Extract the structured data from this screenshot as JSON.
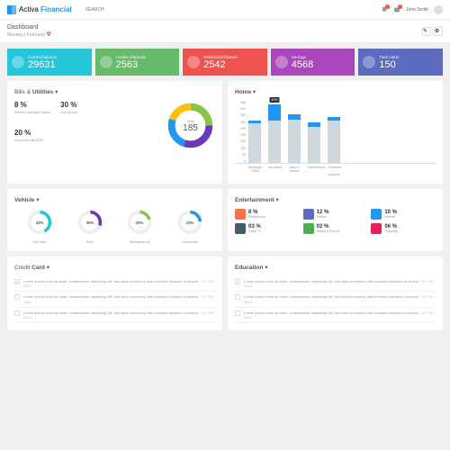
{
  "header": {
    "logo_a": "Activa",
    "logo_b": "Financial",
    "search_placeholder": "SEARCH",
    "notif1": "2",
    "notif2": "3",
    "username": "John Smith"
  },
  "subheader": {
    "title": "Dashboard",
    "date": "Monday | February"
  },
  "tiles": [
    {
      "label": "Current balance",
      "value": "29631"
    },
    {
      "label": "Credits /deposits",
      "value": "2563"
    },
    {
      "label": "Debits/withdrawals",
      "value": "2542"
    },
    {
      "label": "Savings",
      "value": "4568"
    },
    {
      "label": "Total Alerts",
      "value": "150"
    }
  ],
  "bills": {
    "title_a": "Bills &",
    "title_b": "Utilities",
    "stats": [
      {
        "val": "8 %",
        "lbl": "Electric and gas,Water"
      },
      {
        "val": "30 %",
        "lbl": "Cell phone"
      },
      {
        "val": "20 %",
        "lbl": "Land line bill AT&T"
      }
    ],
    "total_label": "Total",
    "total_value": "185"
  },
  "home": {
    "title": "Home",
    "tooltip": "40%"
  },
  "vehicle": {
    "title": "Vehicle",
    "items": [
      {
        "val": "42%",
        "lbl": "Car loan",
        "color": "#26c6da",
        "pct": 42
      },
      {
        "val": "30%",
        "lbl": "Fuel",
        "color": "#673ab7",
        "pct": 30
      },
      {
        "val": "20%",
        "lbl": "Maintenance",
        "color": "#8bc34a",
        "pct": 20
      },
      {
        "val": "23%",
        "lbl": "Insurance",
        "color": "#2196f3",
        "pct": 23
      }
    ]
  },
  "entertainment": {
    "title": "Entertainment",
    "items": [
      {
        "val": "8 %",
        "lbl": "Restaurants",
        "color": "#ff7043"
      },
      {
        "val": "12 %",
        "lbl": "Movies",
        "color": "#5c6bc0"
      },
      {
        "val": "10 %",
        "lbl": "Internet",
        "color": "#2196f3"
      },
      {
        "val": "03 %",
        "lbl": "Cable TV",
        "color": "#455a64"
      },
      {
        "val": "02 %",
        "lbl": "Health & Fitness",
        "color": "#4caf50"
      },
      {
        "val": "06 %",
        "lbl": "Shopping",
        "color": "#e91e63"
      }
    ]
  },
  "credit": {
    "title_a": "Credit",
    "title_b": "Card",
    "items": [
      {
        "checked": true,
        "text": "Lorem ipsum dolor sit amet, consectetuer adipiscing elit, sed diam nonummy nibh euismod tincidunt ut laoreet .",
        "date": "12 / 05 / 2014"
      },
      {
        "checked": false,
        "text": "Lorem ipsum dolor sit amet, consectetuer adipiscing elit, sed diam nonummy nibh euismod tincidunt ut laoreet .",
        "date": "12 / 05 / 2014"
      },
      {
        "checked": false,
        "text": "Lorem ipsum dolor sit amet, consectetuer adipiscing elit, sed diam nonummy nibh euismod tincidunt ut laoreet .",
        "date": "12 / 05 / 2014"
      }
    ]
  },
  "education": {
    "title": "Education",
    "items": [
      {
        "checked": true,
        "text": "Lorem ipsum dolor sit amet, consectetuer adipiscing elit, sed diam nonummy nibh euismod tincidunt ut laoreet .",
        "date": "12 / 05 / 2014"
      },
      {
        "checked": false,
        "text": "Lorem ipsum dolor sit amet, consectetuer adipiscing elit, sed diam nonummy nibh euismod tincidunt ut laoreet .",
        "date": "12 / 05 / 2014"
      },
      {
        "checked": false,
        "text": "Lorem ipsum dolor sit amet, consectetuer adipiscing elit, sed diam nonummy nibh euismod tincidunt ut laoreet .",
        "date": "12 / 05 / 2014"
      }
    ]
  },
  "chart_data": {
    "bills_donut": {
      "type": "pie",
      "title": "Bills & Utilities",
      "total": 185,
      "series": [
        {
          "name": "Electric and gas,Water",
          "value": 8
        },
        {
          "name": "Cell phone",
          "value": 30
        },
        {
          "name": "Land line bill AT&T",
          "value": 20
        },
        {
          "name": "Other",
          "value": 42
        }
      ]
    },
    "home_bars": {
      "type": "bar",
      "ylim": [
        0,
        450
      ],
      "yticks": [
        0,
        50,
        100,
        150,
        200,
        250,
        300,
        350,
        400,
        450
      ],
      "categories": [
        "Mortgage / Rent",
        "Insurance",
        "Lawn & Garden",
        "Maintenance",
        "Groceries / supplies"
      ],
      "series": [
        {
          "name": "base",
          "values": [
            280,
            300,
            310,
            260,
            300
          ],
          "color": "#cfd8dc"
        },
        {
          "name": "top",
          "values": [
            20,
            120,
            40,
            30,
            25
          ],
          "color": "#2196f3"
        }
      ],
      "tooltip": {
        "category": "Insurance",
        "value": "40%"
      }
    },
    "vehicle_donuts": {
      "type": "pie",
      "items": [
        {
          "name": "Car loan",
          "value": 42
        },
        {
          "name": "Fuel",
          "value": 30
        },
        {
          "name": "Maintenance",
          "value": 20
        },
        {
          "name": "Insurance",
          "value": 23
        }
      ]
    }
  }
}
